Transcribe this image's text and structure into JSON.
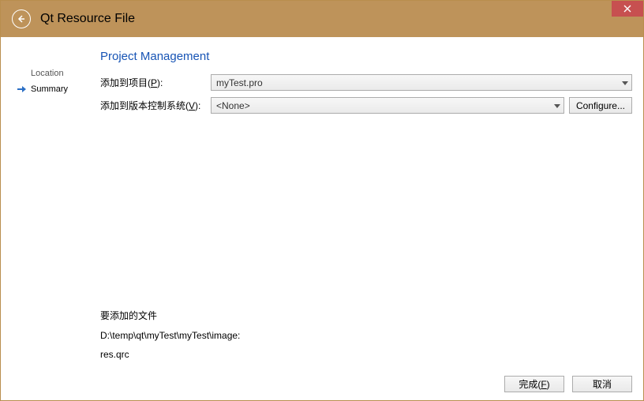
{
  "window": {
    "title": "Qt Resource File"
  },
  "sidebar": {
    "items": [
      {
        "label": "Location",
        "active": false
      },
      {
        "label": "Summary",
        "active": true
      }
    ]
  },
  "page": {
    "heading": "Project Management",
    "add_to_project_label": "添加到项目(P):",
    "add_to_project_hotkey": "P",
    "add_to_project_value": "myTest.pro",
    "add_to_vcs_label": "添加到版本控制系统(V):",
    "add_to_vcs_hotkey": "V",
    "add_to_vcs_value": "<None>",
    "configure_label": "Configure...",
    "files_heading": "要添加的文件",
    "files_path": "D:\\temp\\qt\\myTest\\myTest\\image:",
    "files_list": "res.qrc"
  },
  "footer": {
    "finish_label": "完成(F)",
    "finish_hotkey": "F",
    "cancel_label": "取消"
  }
}
